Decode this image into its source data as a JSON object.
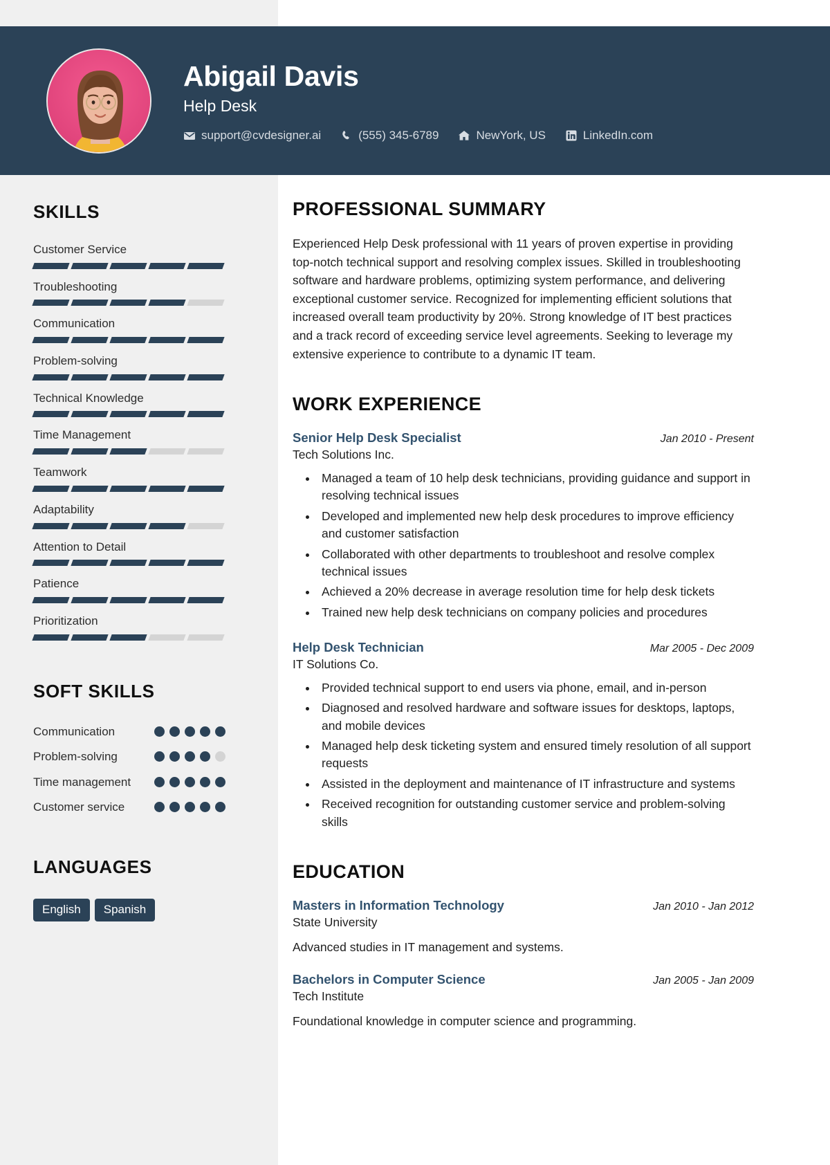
{
  "theme": {
    "primary": "#2b4257",
    "accent_title": "#33536f",
    "sidebar_bg": "#f0f0f0",
    "bar_empty": "#d4d4d4",
    "avatar_bg": "#e8487f"
  },
  "header": {
    "name": "Abigail Davis",
    "role": "Help Desk",
    "contacts": [
      {
        "icon": "envelope-icon",
        "text": "support@cvdesigner.ai"
      },
      {
        "icon": "phone-icon",
        "text": "(555) 345-6789"
      },
      {
        "icon": "home-icon",
        "text": "NewYork, US"
      },
      {
        "icon": "linkedin-icon",
        "text": "LinkedIn.com"
      }
    ]
  },
  "sidebar": {
    "skills_heading": "SKILLS",
    "skills": [
      {
        "label": "Customer Service",
        "filled": 5,
        "total": 5
      },
      {
        "label": "Troubleshooting",
        "filled": 4,
        "total": 5
      },
      {
        "label": "Communication",
        "filled": 5,
        "total": 5
      },
      {
        "label": "Problem-solving",
        "filled": 5,
        "total": 5
      },
      {
        "label": "Technical Knowledge",
        "filled": 5,
        "total": 5
      },
      {
        "label": "Time Management",
        "filled": 3,
        "total": 5
      },
      {
        "label": "Teamwork",
        "filled": 5,
        "total": 5
      },
      {
        "label": "Adaptability",
        "filled": 4,
        "total": 5
      },
      {
        "label": "Attention to Detail",
        "filled": 5,
        "total": 5
      },
      {
        "label": "Patience",
        "filled": 5,
        "total": 5
      },
      {
        "label": "Prioritization",
        "filled": 3,
        "total": 5
      }
    ],
    "soft_skills_heading": "SOFT SKILLS",
    "soft_skills": [
      {
        "label": "Communication",
        "filled": 5,
        "total": 5
      },
      {
        "label": "Problem-solving",
        "filled": 4,
        "total": 5
      },
      {
        "label": "Time management",
        "filled": 5,
        "total": 5
      },
      {
        "label": "Customer service",
        "filled": 5,
        "total": 5
      }
    ],
    "languages_heading": "LANGUAGES",
    "languages": [
      "English",
      "Spanish"
    ]
  },
  "main": {
    "summary_heading": "PROFESSIONAL SUMMARY",
    "summary": "Experienced Help Desk professional with 11 years of proven expertise in providing top-notch technical support and resolving complex issues. Skilled in troubleshooting software and hardware problems, optimizing system performance, and delivering exceptional customer service. Recognized for implementing efficient solutions that increased overall team productivity by 20%. Strong knowledge of IT best practices and a track record of exceeding service level agreements. Seeking to leverage my extensive experience to contribute to a dynamic IT team.",
    "work_heading": "WORK EXPERIENCE",
    "work": [
      {
        "title": "Senior Help Desk Specialist",
        "company": "Tech Solutions Inc.",
        "date": "Jan 2010 - Present",
        "bullets": [
          "Managed a team of 10 help desk technicians, providing guidance and support in resolving technical issues",
          "Developed and implemented new help desk procedures to improve efficiency and customer satisfaction",
          "Collaborated with other departments to troubleshoot and resolve complex technical issues",
          "Achieved a 20% decrease in average resolution time for help desk tickets",
          "Trained new help desk technicians on company policies and procedures"
        ]
      },
      {
        "title": "Help Desk Technician",
        "company": "IT Solutions Co.",
        "date": "Mar 2005 - Dec 2009",
        "bullets": [
          "Provided technical support to end users via phone, email, and in-person",
          "Diagnosed and resolved hardware and software issues for desktops, laptops, and mobile devices",
          "Managed help desk ticketing system and ensured timely resolution of all support requests",
          "Assisted in the deployment and maintenance of IT infrastructure and systems",
          "Received recognition for outstanding customer service and problem-solving skills"
        ]
      }
    ],
    "education_heading": "EDUCATION",
    "education": [
      {
        "degree": "Masters in Information Technology",
        "school": "State University",
        "date": "Jan 2010 - Jan 2012",
        "description": "Advanced studies in IT management and systems."
      },
      {
        "degree": "Bachelors in Computer Science",
        "school": "Tech Institute",
        "date": "Jan 2005 - Jan 2009",
        "description": "Foundational knowledge in computer science and programming."
      }
    ]
  }
}
